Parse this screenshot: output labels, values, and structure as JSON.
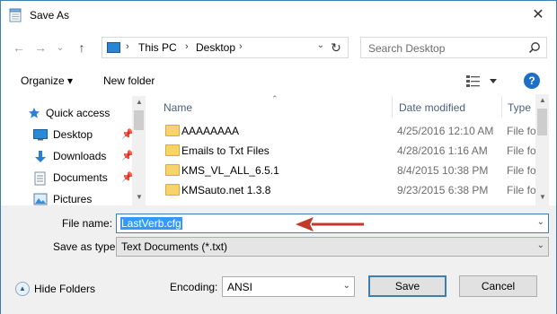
{
  "window": {
    "title": "Save As",
    "close_glyph": "✕"
  },
  "navigation": {
    "back_glyph": "←",
    "forward_glyph": "→",
    "recent_glyph": "⌄",
    "up_glyph": "↑",
    "breadcrumbs": [
      "This PC",
      "Desktop"
    ],
    "refresh_glyph": "↻"
  },
  "search": {
    "placeholder": "Search Desktop"
  },
  "toolbar": {
    "organize_label": "Organize ▾",
    "new_folder_label": "New folder",
    "help_label": "?"
  },
  "nav_pane": {
    "items": [
      {
        "label": "Quick access",
        "icon": "star-icon",
        "pinned": false
      },
      {
        "label": "Desktop",
        "icon": "desktop-icon",
        "pinned": true
      },
      {
        "label": "Downloads",
        "icon": "download-icon",
        "pinned": true
      },
      {
        "label": "Documents",
        "icon": "documents-icon",
        "pinned": true
      },
      {
        "label": "Pictures",
        "icon": "pictures-icon",
        "pinned": false
      }
    ]
  },
  "file_list": {
    "columns": [
      "Name",
      "Date modified",
      "Type"
    ],
    "rows": [
      {
        "name": "AAAAAAAA",
        "date": "4/25/2016 12:10 AM",
        "type": "File fol"
      },
      {
        "name": "Emails to Txt Files",
        "date": "4/28/2016 1:16 AM",
        "type": "File fol"
      },
      {
        "name": "KMS_VL_ALL_6.5.1",
        "date": "8/4/2015 10:38 PM",
        "type": "File fol"
      },
      {
        "name": "KMSauto.net 1.3.8",
        "date": "9/23/2015 6:38 PM",
        "type": "File fol"
      }
    ]
  },
  "form": {
    "file_name_label": "File name:",
    "file_name_value": "LastVerb.cfg",
    "save_type_label": "Save as type:",
    "save_type_value": "Text Documents (*.txt)",
    "encoding_label": "Encoding:",
    "encoding_value": "ANSI",
    "hide_folders_label": "Hide Folders",
    "save_label": "Save",
    "cancel_label": "Cancel"
  },
  "colors": {
    "accent": "#3c7fb1",
    "selection": "#3399ff",
    "annotation_arrow": "#c0392b",
    "folder": "#f7d36b"
  }
}
